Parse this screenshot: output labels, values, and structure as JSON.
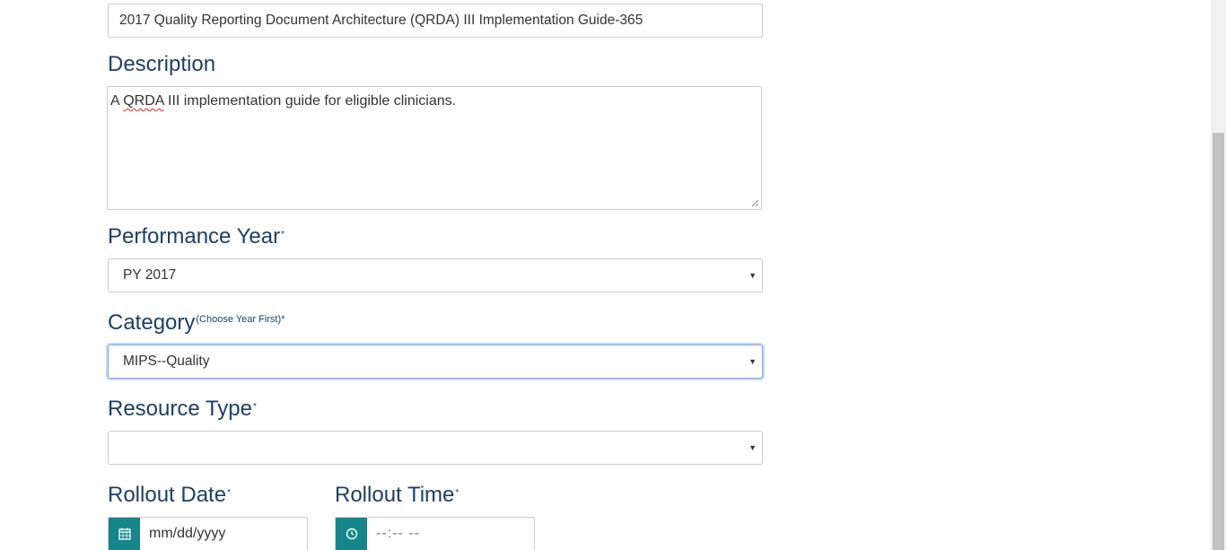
{
  "title_field": {
    "value": "2017 Quality Reporting Document Architecture (QRDA) III Implementation Guide-365"
  },
  "description": {
    "label": "Description",
    "value_before": "A ",
    "value_misspelled": "QRDA",
    "value_after": " III implementation guide for  eligible clinicians."
  },
  "performance_year": {
    "label": "Performance Year",
    "required_mark": "*",
    "selected": "PY 2017"
  },
  "category": {
    "label": "Category",
    "hint": "(Choose Year First)*",
    "selected": "MIPS--Quality"
  },
  "resource_type": {
    "label": "Resource Type",
    "required_mark": "*",
    "selected": ""
  },
  "rollout_date": {
    "label": "Rollout Date",
    "required_mark": "*",
    "placeholder": "mm/dd/yyyy",
    "icon": "calendar-icon"
  },
  "rollout_time": {
    "label": "Rollout Time",
    "required_mark": "*",
    "placeholder": "--:-- --",
    "icon": "clock-icon"
  },
  "colors": {
    "label": "#1d3f66",
    "addon": "#16868a",
    "focus": "#7aa6e6"
  }
}
